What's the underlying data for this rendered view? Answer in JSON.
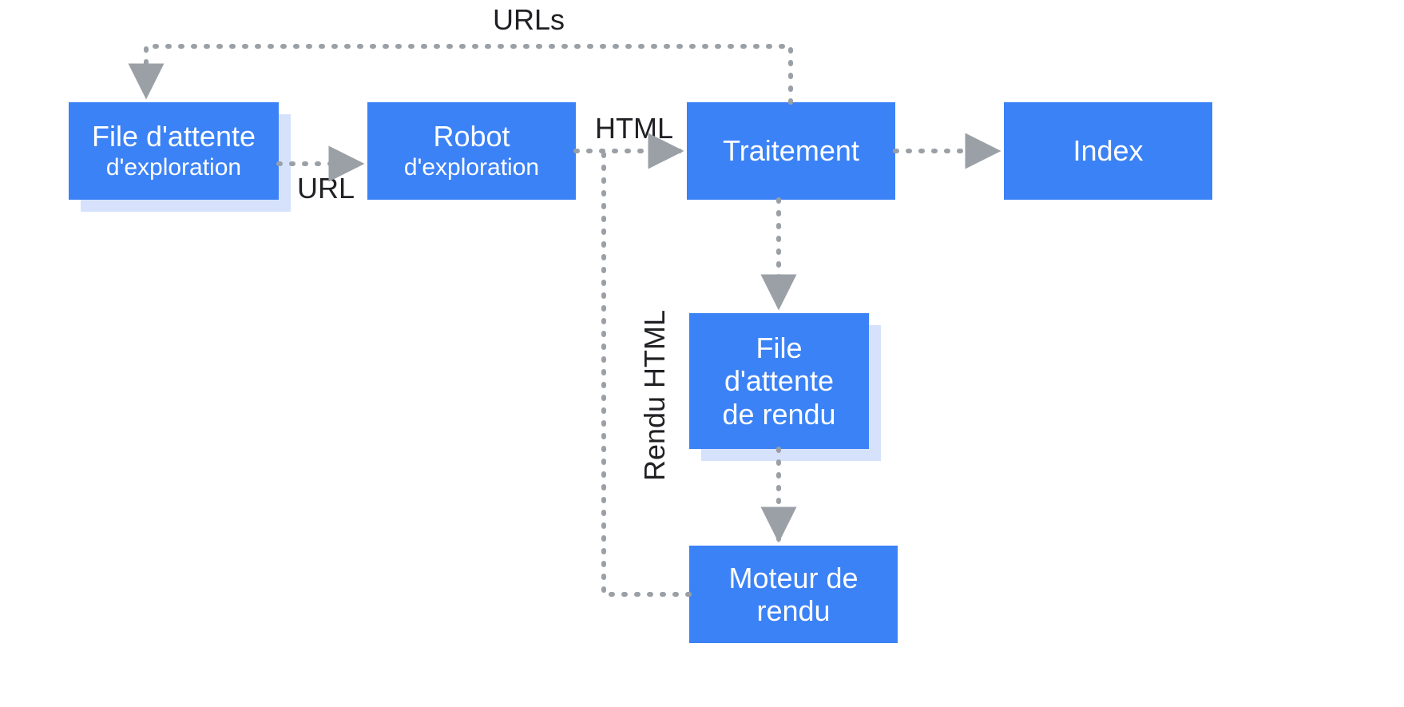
{
  "nodes": {
    "crawl_queue": {
      "main": "File d'attente",
      "sub": "d'exploration"
    },
    "crawler": {
      "main": "Robot",
      "sub": "d'exploration"
    },
    "processing": {
      "main": "Traitement"
    },
    "index": {
      "main": "Index"
    },
    "render_queue": {
      "line1": "File",
      "line2": "d'attente",
      "line3": "de rendu"
    },
    "renderer": {
      "line1": "Moteur de",
      "line2": "rendu"
    }
  },
  "edges": {
    "queue_to_crawler": "URL",
    "crawler_to_proc": "HTML",
    "proc_back_to_queue": "URLs",
    "renderer_to_proc": "Rendu HTML"
  },
  "colors": {
    "node_fill": "#3b82f6",
    "node_shadow": "#d6e2fb",
    "arrow": "#9aa0a6",
    "text_dark": "#202124"
  }
}
